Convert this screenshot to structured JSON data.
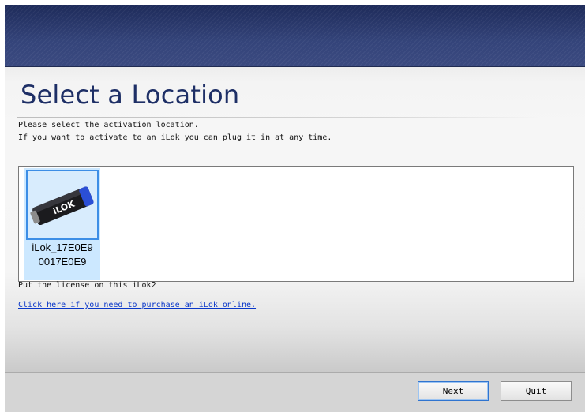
{
  "header": {
    "title": "Select a Location",
    "line1": "Please select the activation location.",
    "line2": "If you want to activate to an iLok you can plug it in at any time."
  },
  "devices": [
    {
      "icon": "ilok-usb-key-icon",
      "logo_text": "iLOK",
      "label_line1": "iLok_17E0E9",
      "label_line2": "0017E0E9",
      "selected": true
    }
  ],
  "status": {
    "put_license": "Put the license on this iLok2",
    "purchase_link": "Click here if you need to purchase an iLok online."
  },
  "buttons": {
    "next": "Next",
    "quit": "Quit"
  },
  "colors": {
    "title": "#1e2f66",
    "banner": "#34447a",
    "link": "#0a37c9",
    "selection": "#cce8ff",
    "selection_border": "#3d8ee6"
  }
}
